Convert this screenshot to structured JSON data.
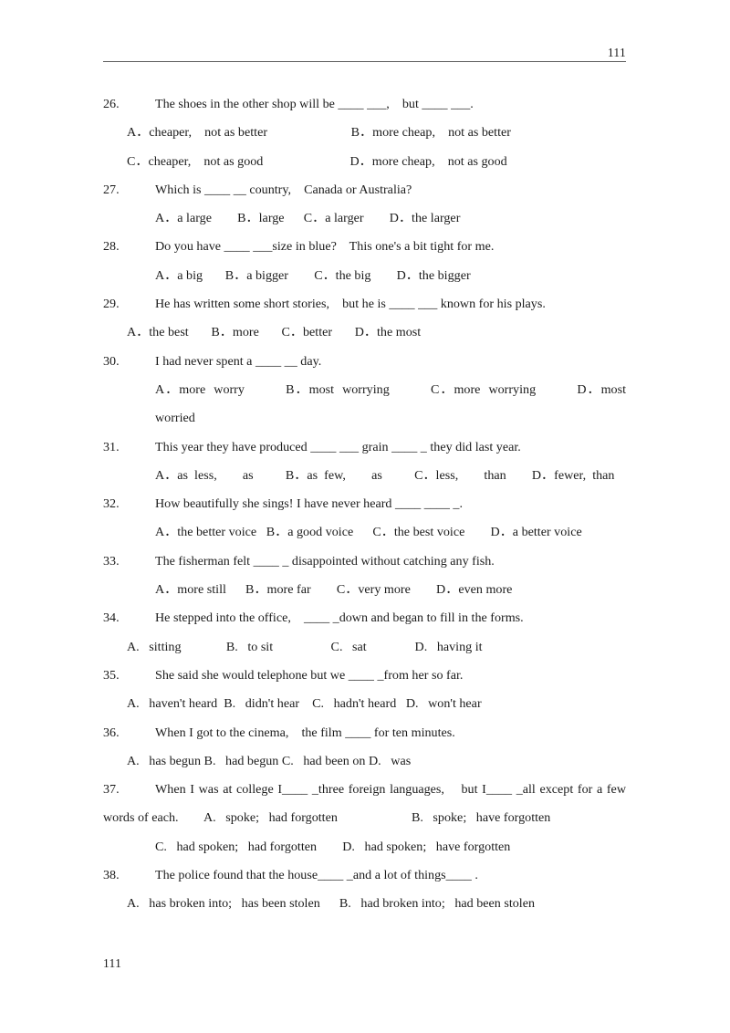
{
  "header": {
    "page_number": "111"
  },
  "footer": {
    "page_number": "111"
  },
  "questions": [
    {
      "number": "26.",
      "stem": "The shoes in the other shop will be ____ ___,    but ____ ___.",
      "option_lines": [
        "A．cheaper,    not as better                          B．more cheap,    not as better",
        "C．cheaper,    not as good                           D．more cheap,    not as good"
      ]
    },
    {
      "number": "27.",
      "stem": "Which is ____ __ country,    Canada or Australia?",
      "option_lines": [
        "A．a large        B．large      C．a larger        D．the larger"
      ]
    },
    {
      "number": "28.",
      "stem": "Do you have ____ ___size in blue?    This one's a bit tight for me.",
      "option_lines": [
        "A．a big       B．a bigger        C．the big        D．the bigger"
      ]
    },
    {
      "number": "29.",
      "stem": "He has written some short stories,    but he is ____ ___ known for his plays.",
      "option_lines": [
        "A．the best       B．more       C．better       D．the most"
      ]
    },
    {
      "number": "30.",
      "stem": "I had never spent a ____ __ day.",
      "option_lines": [
        "A．more  worry          B．most  worrying          C．more  worrying          D．most  worried"
      ]
    },
    {
      "number": "31.",
      "stem": "This year they have produced ____ ___ grain ____ _ they did last year.",
      "option_lines": [
        "A．as  less,        as          B．as  few,        as          C．less,        than        D．fewer,  than"
      ]
    },
    {
      "number": "32.",
      "stem": "How beautifully she sings! I have never heard ____ ____ _.",
      "option_lines": [
        "A．the better voice   B．a good voice      C．the best voice        D．a better voice"
      ]
    },
    {
      "number": "33.",
      "stem": "The fisherman felt ____ _ disappointed without catching any fish.",
      "option_lines": [
        "A．more still      B．more far        C．very more        D．even more"
      ]
    },
    {
      "number": "34.",
      "stem": "He stepped into the office,    ____ _down and began to fill in the forms.",
      "option_lines": [
        "A.   sitting              B.   to sit                  C.   sat               D.   having it"
      ]
    },
    {
      "number": "35.",
      "stem": "She said she would telephone but we ____ _from her so far.",
      "option_lines": [
        "A.   haven't heard  B.   didn't hear    C.   hadn't heard   D.   won't hear"
      ]
    },
    {
      "number": "36.",
      "stem": "When I got to the cinema,    the film ____ for ten minutes.",
      "option_lines": [
        "A.   has begun B.   had begun C.   had been on D.   was"
      ]
    },
    {
      "number": "37.",
      "stem": "When I was at college I____ _three foreign languages,    but I____ _all except for a few words of each.        A.   spoke;   had forgotten                       B.   spoke;   have forgotten",
      "option_lines": [
        "C.   had spoken;   had forgotten        D.   had spoken;   have forgotten"
      ]
    },
    {
      "number": "38.",
      "stem": "The police found that the house____ _and a lot of things____ .",
      "option_lines": [
        "A.   has broken into;   has been stolen      B.   had broken into;   had been stolen"
      ]
    }
  ]
}
